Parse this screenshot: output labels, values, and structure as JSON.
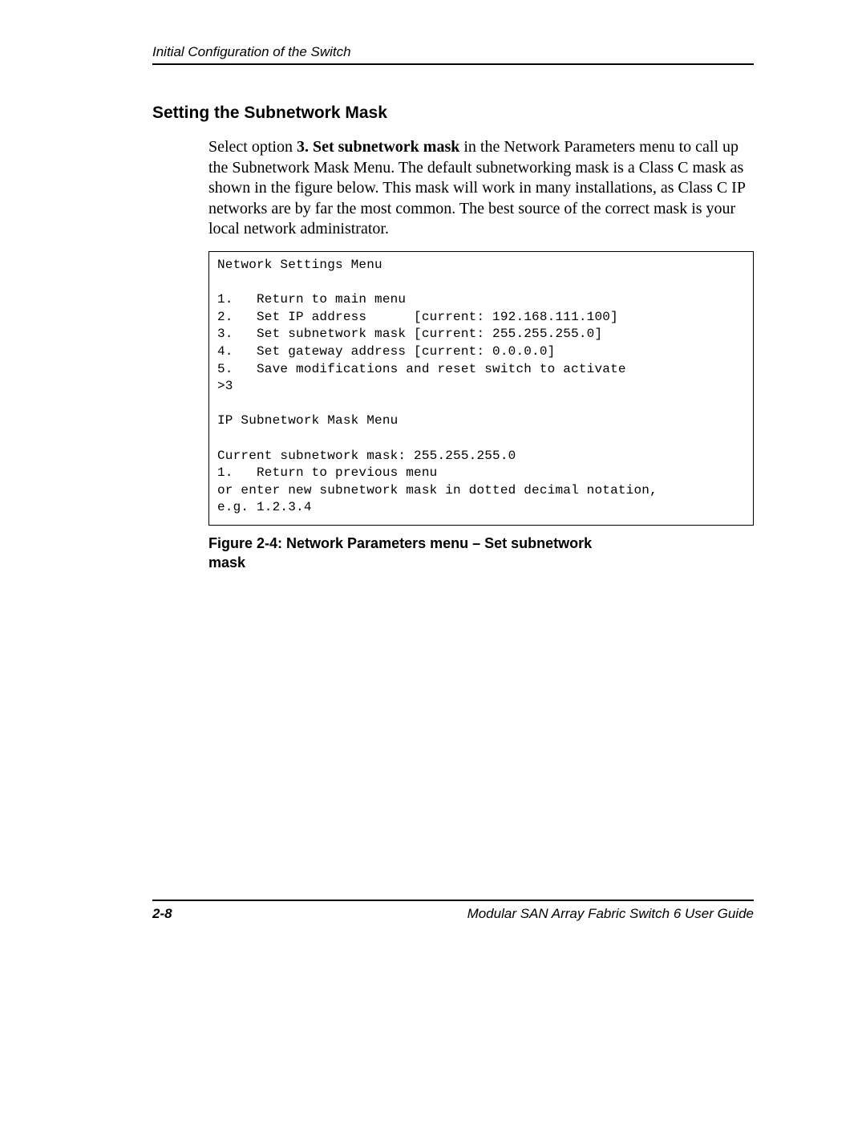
{
  "header": {
    "running_head": "Initial Configuration of the Switch"
  },
  "section": {
    "heading": "Setting the Subnetwork Mask",
    "para_pre": "Select option ",
    "para_bold": "3. Set subnetwork mask",
    "para_post": " in the Network Parameters menu to call up the Subnetwork Mask Menu. The default subnetworking mask is a Class C mask as shown in the figure below. This mask will work in many installations, as Class C IP networks are by far the most common. The best source of the correct mask is your local network administrator."
  },
  "terminal": {
    "text": "Network Settings Menu\n\n1.   Return to main menu\n2.   Set IP address      [current: 192.168.111.100]\n3.   Set subnetwork mask [current: 255.255.255.0]\n4.   Set gateway address [current: 0.0.0.0]\n5.   Save modifications and reset switch to activate\n>3\n\nIP Subnetwork Mask Menu\n\nCurrent subnetwork mask: 255.255.255.0\n1.   Return to previous menu\nor enter new subnetwork mask in dotted decimal notation,\ne.g. 1.2.3.4"
  },
  "figure": {
    "caption": "Figure 2-4:  Network Parameters menu – Set subnetwork mask"
  },
  "footer": {
    "page_num": "2-8",
    "doc_title": "Modular SAN Array Fabric Switch 6 User Guide"
  }
}
